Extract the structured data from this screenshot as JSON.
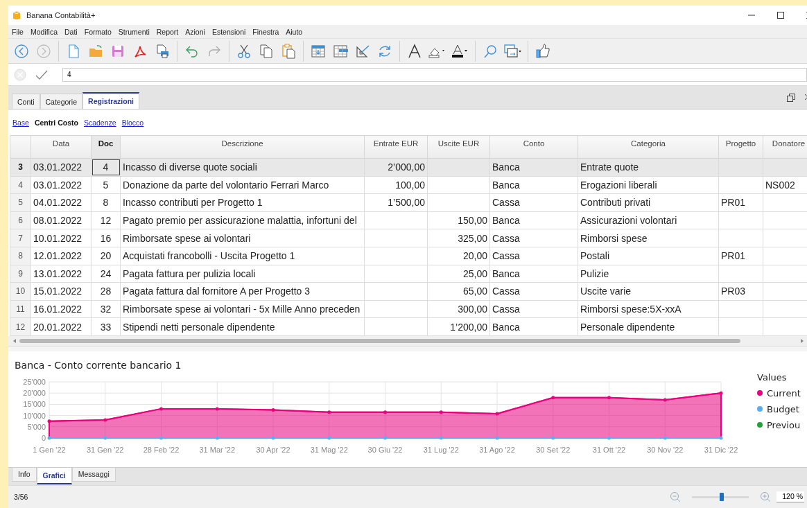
{
  "window": {
    "title": "Banana Contabilità+"
  },
  "menu": [
    "File",
    "Modifica",
    "Dati",
    "Formato",
    "Strumenti",
    "Report",
    "Azioni",
    "Estensioni",
    "Finestra",
    "Aiuto"
  ],
  "entry": {
    "value": "4"
  },
  "tabs": [
    {
      "label": "Conti",
      "selected": false
    },
    {
      "label": "Categorie",
      "selected": false
    },
    {
      "label": "Registrazioni",
      "selected": true
    }
  ],
  "views": [
    {
      "label": "Base",
      "selected": false
    },
    {
      "label": "Centri Costo",
      "selected": true
    },
    {
      "label": "Scadenze",
      "selected": false
    },
    {
      "label": "Blocco",
      "selected": false
    }
  ],
  "table": {
    "columns": [
      {
        "label": "Data",
        "selected": false
      },
      {
        "label": "Doc",
        "selected": true
      },
      {
        "label": "Descrizione",
        "selected": false
      },
      {
        "label": "Entrate EUR",
        "selected": false
      },
      {
        "label": "Uscite EUR",
        "selected": false
      },
      {
        "label": "Conto",
        "selected": false
      },
      {
        "label": "Categoria",
        "selected": false
      },
      {
        "label": "Progetto",
        "selected": false
      },
      {
        "label": "Donatore",
        "selected": false
      }
    ],
    "rows": [
      {
        "number": "3",
        "selected": true,
        "cells": [
          "03.01.2022",
          "4",
          "Incasso di diverse quote sociali",
          "2’000,00",
          null,
          "Banca",
          "Entrate quote",
          null,
          null
        ]
      },
      {
        "number": "4",
        "selected": false,
        "cells": [
          "03.01.2022",
          "5",
          "Donazione da parte del volontario Ferrari Marco",
          "100,00",
          null,
          "Banca",
          "Erogazioni liberali",
          null,
          "NS002"
        ]
      },
      {
        "number": "5",
        "selected": false,
        "cells": [
          "04.01.2022",
          "8",
          "Incasso contributi per Progetto 1",
          "1’500,00",
          null,
          "Cassa",
          "Contributi privati",
          "PR01",
          null
        ]
      },
      {
        "number": "6",
        "selected": false,
        "cells": [
          "08.01.2022",
          "12",
          "Pagato premio per assicurazione malattia, infortuni del",
          null,
          "150,00",
          "Banca",
          "Assicurazioni volontari",
          null,
          null
        ]
      },
      {
        "number": "7",
        "selected": false,
        "cells": [
          "10.01.2022",
          "16",
          "Rimborsate spese ai volontari",
          null,
          "325,00",
          "Cassa",
          "Rimborsi spese",
          null,
          null
        ]
      },
      {
        "number": "8",
        "selected": false,
        "cells": [
          "12.01.2022",
          "20",
          "Acquistati francobolli - Uscita Progetto 1",
          null,
          "20,00",
          "Cassa",
          "Postali",
          "PR01",
          null
        ]
      },
      {
        "number": "9",
        "selected": false,
        "cells": [
          "13.01.2022",
          "24",
          "Pagata fattura per pulizia locali",
          null,
          "25,00",
          "Banca",
          "Pulizie",
          null,
          null
        ]
      },
      {
        "number": "10",
        "selected": false,
        "cells": [
          "15.01.2022",
          "28",
          "Pagata fattura dal fornitore A per Progetto 3",
          null,
          "65,00",
          "Cassa",
          "Uscite varie",
          "PR03",
          null
        ]
      },
      {
        "number": "11",
        "selected": false,
        "cells": [
          "16.01.2022",
          "32",
          "Rimborsate spese ai volontari - 5x Mille Anno preceden",
          null,
          "300,00",
          "Cassa",
          "Rimborsi spese:5X-xxA",
          null,
          null
        ]
      },
      {
        "number": "12",
        "selected": false,
        "cells": [
          "20.01.2022",
          "33",
          "Stipendi netti personale dipendente",
          null,
          "1’200,00",
          "Banca",
          "Personale dipendente",
          null,
          null
        ]
      }
    ]
  },
  "chart": {
    "title": "Banca - Conto corrente bancario 1",
    "legend_title": "Values",
    "chart_data": {
      "type": "area",
      "categories": [
        "1 Gen '22",
        "31 Gen '22",
        "28 Feb '22",
        "31 Mar '22",
        "30 Apr '22",
        "31 Mag '22",
        "30 Giu '22",
        "31 Lug '22",
        "31 Ago '22",
        "30 Set '22",
        "31 Ott '22",
        "30 Nov '22",
        "31 Dic '22"
      ],
      "series": [
        {
          "name": "Current",
          "color": "#e8007e",
          "values": [
            7500,
            8000,
            13000,
            13000,
            12500,
            11500,
            11500,
            11500,
            10800,
            18000,
            18000,
            17000,
            20000
          ]
        },
        {
          "name": "Budget",
          "color": "#5aaef0",
          "type": "line",
          "values": [
            0,
            0,
            0,
            0,
            0,
            0,
            0,
            0,
            0,
            0,
            0,
            0,
            0
          ]
        },
        {
          "name": "Previou",
          "color": "#22a33a",
          "values": [
            null,
            null,
            null,
            null,
            null,
            null,
            null,
            null,
            null,
            null,
            null,
            null,
            null
          ]
        }
      ],
      "ylim": [
        0,
        25000
      ],
      "grid": true,
      "yticks": [
        {
          "value": 0,
          "label": "0"
        },
        {
          "value": 5000,
          "label": "5'000"
        },
        {
          "value": 10000,
          "label": "10'000"
        },
        {
          "value": 15000,
          "label": "15'000"
        },
        {
          "value": 20000,
          "label": "20'000"
        },
        {
          "value": 25000,
          "label": "25'000"
        }
      ]
    }
  },
  "bottom_tabs": [
    {
      "label": "Info",
      "selected": false
    },
    {
      "label": "Grafici",
      "selected": true
    },
    {
      "label": "Messaggi",
      "selected": false
    }
  ],
  "status": {
    "position": "3/56",
    "zoom": {
      "level": 0.52,
      "value": "120 %"
    }
  }
}
